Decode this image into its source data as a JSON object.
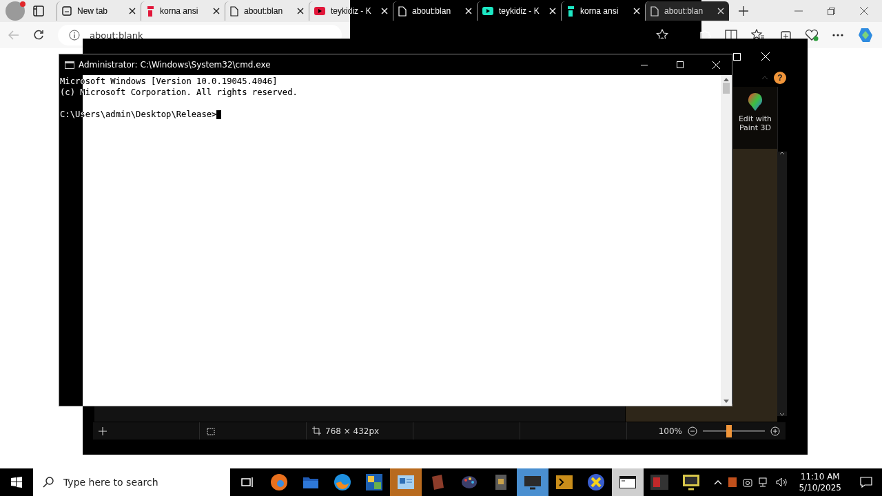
{
  "browser": {
    "tabs": [
      {
        "title": "New tab",
        "kind": "newtab",
        "selected": false
      },
      {
        "title": "korna ansi",
        "kind": "site",
        "color": "#e2173a",
        "selected": false
      },
      {
        "title": "about:blan",
        "kind": "page",
        "selected": false
      },
      {
        "title": "teykidiz - K",
        "kind": "youtube",
        "color": "#e2173a",
        "selected": false
      },
      {
        "title": "about:blan",
        "kind": "page",
        "selected": false
      },
      {
        "title": "teykidiz - K",
        "kind": "youtube",
        "color": "#1de8c5",
        "selected": false
      },
      {
        "title": "korna ansi",
        "kind": "site",
        "color": "#1de8c5",
        "selected": false
      },
      {
        "title": "about:blan",
        "kind": "page",
        "selected": true
      }
    ],
    "address": "about:blank"
  },
  "cmd": {
    "title": "Administrator: C:\\Windows\\System32\\cmd.exe",
    "header_lines": [
      "Microsoft Windows [Version 10.0.19045.4046]",
      "(c) Microsoft Corporation. All rights reserved."
    ],
    "prompt": "C:\\Users\\admin\\Desktop\\Release>"
  },
  "paint": {
    "panel_button": "Edit with Paint 3D",
    "help": "?",
    "status": {
      "size": "768 × 432px",
      "zoom": "100%",
      "level": 0.42
    }
  },
  "taskbar": {
    "search_placeholder": "Type here to search",
    "apps": [
      {
        "kind": "taskview"
      },
      {
        "kind": "edge"
      },
      {
        "kind": "explorer"
      },
      {
        "kind": "firefox"
      },
      {
        "kind": "image"
      },
      {
        "kind": "card",
        "color": "#b86a1e"
      },
      {
        "kind": "book"
      },
      {
        "kind": "palette"
      },
      {
        "kind": "archive"
      },
      {
        "kind": "monitor",
        "color": "#4a8fd0"
      },
      {
        "kind": "terminal"
      },
      {
        "kind": "xtool"
      },
      {
        "kind": "cmd",
        "color": "#cfcfcf"
      },
      {
        "kind": "media"
      },
      {
        "kind": "display"
      }
    ],
    "time": "11:10 AM",
    "date": "5/10/2025"
  }
}
